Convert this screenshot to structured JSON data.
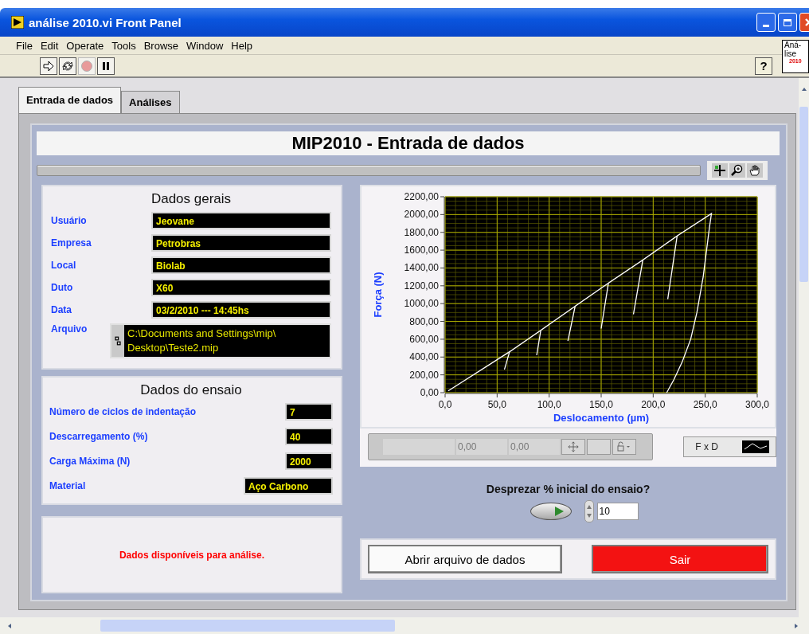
{
  "window": {
    "title": "análise 2010.vi Front Panel"
  },
  "menu": [
    "File",
    "Edit",
    "Operate",
    "Tools",
    "Browse",
    "Window",
    "Help"
  ],
  "vi_icon": {
    "lines": [
      "Aná-",
      "lise"
    ],
    "badge": "2010"
  },
  "tabs": [
    {
      "label": "Entrada de dados",
      "selected": true
    },
    {
      "label": "Análises",
      "selected": false
    }
  ],
  "header": "MIP2010 - Entrada de dados",
  "dados_gerais": {
    "title": "Dados gerais",
    "fields": [
      {
        "label": "Usuário",
        "value": "Jeovane"
      },
      {
        "label": "Empresa",
        "value": "Petrobras"
      },
      {
        "label": "Local",
        "value": "Biolab"
      },
      {
        "label": "Duto",
        "value": "X60"
      },
      {
        "label": "Data",
        "value": "03/2/2010  ---  14:45hs"
      }
    ],
    "path": {
      "label": "Arquivo",
      "lines": [
        "C:\\Documents and Settings\\mip\\",
        "Desktop\\Teste2.mip"
      ]
    }
  },
  "dados_ensaio": {
    "title": "Dados do ensaio",
    "fields": [
      {
        "label": "Número de ciclos de indentação",
        "value": "7",
        "kind": "short"
      },
      {
        "label": "Descarregamento (%)",
        "value": "40",
        "kind": "short"
      },
      {
        "label": "Carga Máxima (N)",
        "value": "2000",
        "kind": "short"
      },
      {
        "label": "Material",
        "value": "Aço Carbono",
        "kind": "wide"
      }
    ]
  },
  "status_message": "Dados disponíveis para análise.",
  "help_button": "?",
  "chart": {
    "chart_data": {
      "type": "line",
      "grid": true,
      "xlabel": "Deslocamento (µm)",
      "ylabel": "Força (N)",
      "xlim": [
        0,
        300
      ],
      "ylim": [
        0,
        2200
      ],
      "xticks": [
        {
          "value": 0,
          "label": "0,0"
        },
        {
          "value": 50,
          "label": "50,0"
        },
        {
          "value": 100,
          "label": "100,0"
        },
        {
          "value": 150,
          "label": "150,0"
        },
        {
          "value": 200,
          "label": "200,0"
        },
        {
          "value": 250,
          "label": "250,0"
        },
        {
          "value": 300,
          "label": "300,0"
        }
      ],
      "yticks": [
        {
          "value": 0,
          "label": "0,00"
        },
        {
          "value": 200,
          "label": "200,00"
        },
        {
          "value": 400,
          "label": "400,00"
        },
        {
          "value": 600,
          "label": "600,00"
        },
        {
          "value": 800,
          "label": "800,00"
        },
        {
          "value": 1000,
          "label": "1000,00"
        },
        {
          "value": 1200,
          "label": "1200,00"
        },
        {
          "value": 1400,
          "label": "1400,00"
        },
        {
          "value": 1600,
          "label": "1600,00"
        },
        {
          "value": 1800,
          "label": "1800,00"
        },
        {
          "value": 2000,
          "label": "2000,00"
        },
        {
          "value": 2200,
          "label": "2200,00"
        }
      ],
      "x": [
        3,
        62,
        57,
        62,
        92,
        88,
        92,
        125,
        118,
        125,
        157,
        150,
        157,
        190,
        181,
        190,
        223,
        214,
        223,
        256,
        254,
        248,
        242,
        236,
        228,
        220,
        213
      ],
      "series": [
        {
          "name": "F x D",
          "color": "#ffffff",
          "values": [
            20,
            460,
            260,
            460,
            700,
            420,
            700,
            970,
            580,
            970,
            1230,
            720,
            1230,
            1490,
            880,
            1490,
            1760,
            1050,
            1760,
            2010,
            1850,
            1300,
            900,
            600,
            350,
            150,
            0
          ]
        }
      ]
    },
    "cursor_values": [
      "0,00",
      "0,00"
    ]
  },
  "discard": {
    "label": "Desprezar % inicial do ensaio?",
    "on": true,
    "value": "10"
  },
  "buttons": [
    {
      "label": "Abrir arquivo de dados",
      "kind": "normal"
    },
    {
      "label": "Sair",
      "kind": "danger"
    }
  ]
}
